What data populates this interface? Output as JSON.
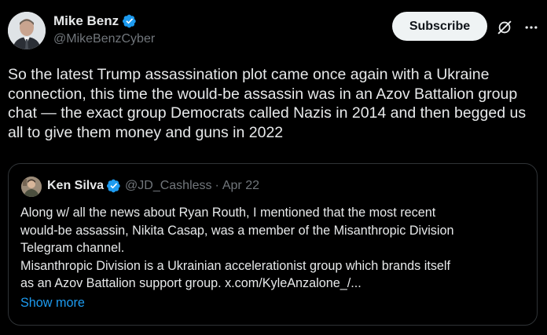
{
  "colors": {
    "background": "#000000",
    "text_primary": "#e7e9ea",
    "text_secondary": "#71767b",
    "accent": "#1d9bf0",
    "border": "#2f3336",
    "subscribe_bg": "#eff3f4"
  },
  "tweet": {
    "author": {
      "name": "Mike Benz",
      "handle": "@MikeBenzCyber",
      "verified_icon": "verified-badge-icon"
    },
    "actions": {
      "subscribe_label": "Subscribe",
      "grok_icon": "grok-icon",
      "more_icon": "more-options-icon"
    },
    "text": "So the latest Trump assassination plot came once again with a Ukraine connection, this time the would-be assassin was in an Azov Battalion group chat — the exact group Democrats called Nazis in 2014 and then begged us all to give them money and guns in 2022",
    "quote": {
      "author": {
        "name": "Ken Silva",
        "handle": "@JD_Cashless",
        "separator": "·",
        "date": "Apr 22"
      },
      "lines": [
        "Along w/ all the news about Ryan Routh, I mentioned that the most recent",
        "would-be assassin, Nikita Casap, was a member of the Misanthropic Division",
        "Telegram channel.",
        "Misanthropic Division is a Ukrainian accelerationist group which brands itself",
        "as an Azov Battalion support group. x.com/KyleAnzalone_/..."
      ],
      "show_more_label": "Show more"
    }
  }
}
